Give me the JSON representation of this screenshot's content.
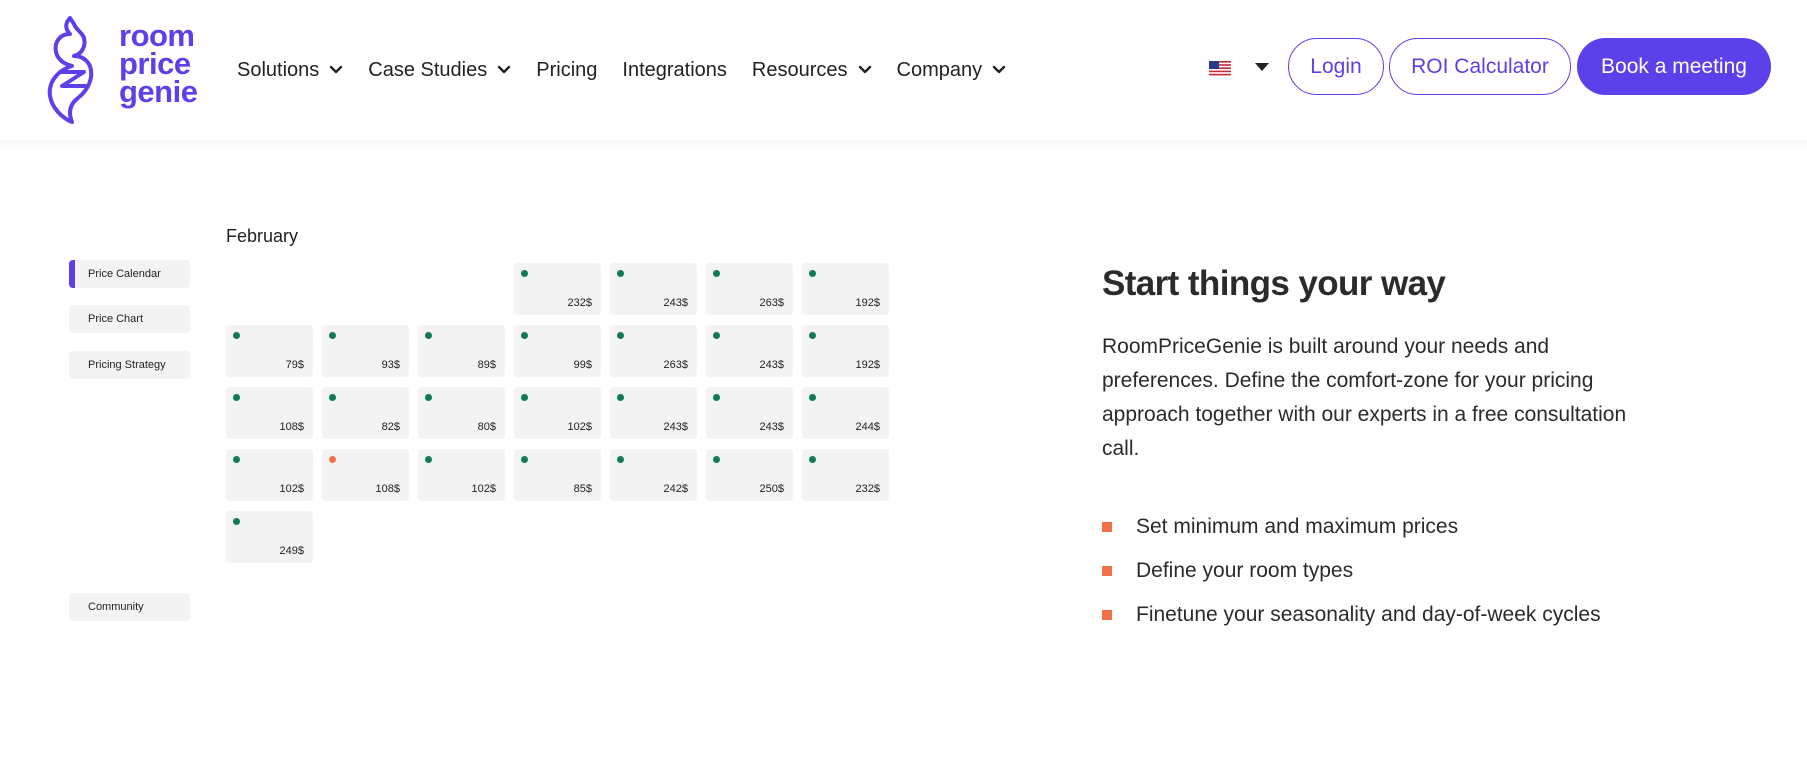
{
  "brand": {
    "logo_lines": [
      "room",
      "price",
      "genie"
    ],
    "color": "#5b41ea"
  },
  "nav": {
    "items": [
      {
        "label": "Solutions",
        "dropdown": true
      },
      {
        "label": "Case Studies",
        "dropdown": true
      },
      {
        "label": "Pricing",
        "dropdown": false
      },
      {
        "label": "Integrations",
        "dropdown": false
      },
      {
        "label": "Resources",
        "dropdown": true
      },
      {
        "label": "Company",
        "dropdown": true
      }
    ]
  },
  "language": {
    "icon": "us-flag-icon"
  },
  "actions": {
    "login": "Login",
    "roi": "ROI Calculator",
    "book": "Book a meeting"
  },
  "sidebar": {
    "items": [
      "Price Calendar",
      "Price Chart",
      "Pricing Strategy"
    ],
    "active": "Price Calendar",
    "bottom": "Community"
  },
  "calendar": {
    "month": "February",
    "leading_empty": 3,
    "days": [
      {
        "price": "232$",
        "status": "ok"
      },
      {
        "price": "243$",
        "status": "ok"
      },
      {
        "price": "263$",
        "status": "ok"
      },
      {
        "price": "192$",
        "status": "ok"
      },
      {
        "price": "79$",
        "status": "ok"
      },
      {
        "price": "93$",
        "status": "ok"
      },
      {
        "price": "89$",
        "status": "ok"
      },
      {
        "price": "99$",
        "status": "ok"
      },
      {
        "price": "263$",
        "status": "ok"
      },
      {
        "price": "243$",
        "status": "ok"
      },
      {
        "price": "192$",
        "status": "ok"
      },
      {
        "price": "108$",
        "status": "ok"
      },
      {
        "price": "82$",
        "status": "ok"
      },
      {
        "price": "80$",
        "status": "ok"
      },
      {
        "price": "102$",
        "status": "ok"
      },
      {
        "price": "243$",
        "status": "ok"
      },
      {
        "price": "243$",
        "status": "ok"
      },
      {
        "price": "244$",
        "status": "ok"
      },
      {
        "price": "102$",
        "status": "ok"
      },
      {
        "price": "108$",
        "status": "warn"
      },
      {
        "price": "102$",
        "status": "ok"
      },
      {
        "price": "85$",
        "status": "ok"
      },
      {
        "price": "242$",
        "status": "ok"
      },
      {
        "price": "250$",
        "status": "ok"
      },
      {
        "price": "232$",
        "status": "ok"
      },
      {
        "price": "249$",
        "status": "ok"
      }
    ],
    "colors": {
      "ok": "#0e7a55",
      "warn": "#f0704a"
    }
  },
  "content": {
    "heading": "Start things your way",
    "paragraph": "RoomPriceGenie is built around your needs and preferences. Define the comfort-zone for your pricing approach together with our experts in a free consultation call.",
    "bullets": [
      "Set minimum and maximum prices",
      "Define your room types",
      "Finetune your seasonality and day-of-week cycles"
    ],
    "bullet_color": "#f0704a"
  }
}
